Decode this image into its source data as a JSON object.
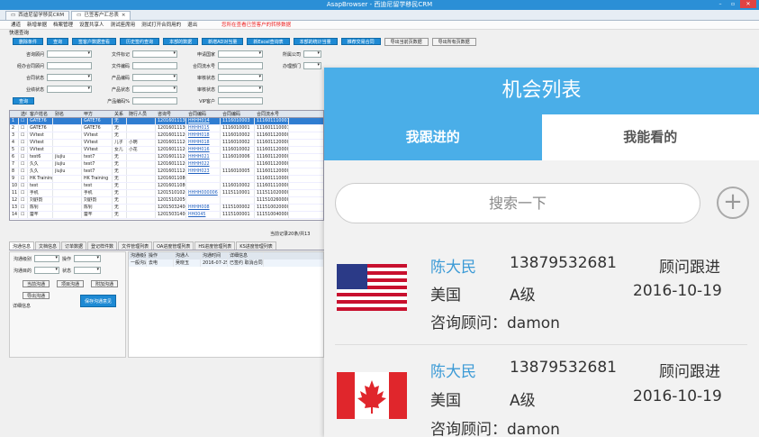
{
  "crm": {
    "window_title": "AsapBrowser - 西迪尼留学移民CRM",
    "tabs": [
      {
        "label": "西迪尼留学移民CRM"
      },
      {
        "label": "已签客户汇总表"
      }
    ],
    "menu": [
      "通道",
      "新增单据",
      "档案管理",
      "设置共享人",
      "测试座席用",
      "测试打开合同用的",
      "退出"
    ],
    "menu_warning": "您所在查看已签客户的转移数据",
    "quick_label": "快速查询",
    "buttons": [
      "删除条件",
      "查询",
      "签客户数据查看",
      "历史签约查询",
      "本部的数据",
      "新增AD对当量",
      "新Excel查询表",
      "本部的统计当量",
      "推荐交易合同"
    ],
    "buttons2": [
      "导出当前页数据",
      "导出所有页数据"
    ],
    "form_labels": [
      "咨询顾问",
      "文件标记",
      "申请国家",
      "所属公司",
      "来自渠道",
      "合同生成日期",
      "经办合同顾问",
      "文件编码",
      "合同流水号",
      "办理部门",
      "合同状态",
      "产品编码",
      "审核状态",
      "业绩状态",
      "产品状态",
      "来源状态",
      "审核状态",
      "VIP客户",
      "产品编码%"
    ],
    "form_values": {
      "source": "D",
      "date_sep": "至"
    },
    "search_btn": "查询",
    "grid_headers": [
      "选中",
      "客户姓名",
      "别名",
      "甲方",
      "关系",
      "随行人员",
      "咨询号",
      "合同编码",
      "合同编码",
      "合同流水号"
    ],
    "rows": [
      {
        "n": "1",
        "name": "GATE76",
        "alias": "",
        "party": "GATE76",
        "rel": "无",
        "comp": "",
        "ask": "120160111300001",
        "code": "HHHH014",
        "code2": "1116010003",
        "serial": "1116011100012"
      },
      {
        "n": "2",
        "name": "GATE76",
        "alias": "",
        "party": "GATE76",
        "rel": "无",
        "comp": "",
        "ask": "120160111300001",
        "code": "HHHH015",
        "code2": "1116010001",
        "serial": "1116011100011"
      },
      {
        "n": "3",
        "name": "VVtest",
        "alias": "",
        "party": "VVtest",
        "rel": "无",
        "comp": "",
        "ask": "120160111200004",
        "code": "HHHH018",
        "code2": "1116010002",
        "serial": "1116011200001"
      },
      {
        "n": "4",
        "name": "VVtest",
        "alias": "",
        "party": "VVtest",
        "rel": "儿子",
        "comp": "小明",
        "ask": "120160111200004",
        "code": "HHHH018",
        "code2": "1116010002",
        "serial": "1116011200003"
      },
      {
        "n": "5",
        "name": "VVtest",
        "alias": "",
        "party": "VVtest",
        "rel": "女儿",
        "comp": "小花",
        "ask": "120160111200004",
        "code": "HHHH016",
        "code2": "1116010002",
        "serial": "1116011200002"
      },
      {
        "n": "6",
        "name": "test6",
        "alias": "jiujiu",
        "party": "test7",
        "rel": "无",
        "comp": "",
        "ask": "120160111200003",
        "code": "HHHH021",
        "code2": "1116010006",
        "serial": "1116011200004"
      },
      {
        "n": "7",
        "name": "久久",
        "alias": "jiujiu",
        "party": "test7",
        "rel": "无",
        "comp": "",
        "ask": "120160111200002",
        "code": "HHHH022",
        "code2": "",
        "serial": "1116011200003"
      },
      {
        "n": "8",
        "name": "久久",
        "alias": "jiujiu",
        "party": "test7",
        "rel": "无",
        "comp": "",
        "ask": "120160111200002",
        "code": "HHHH023",
        "code2": "1116010005",
        "serial": "1116011200002"
      },
      {
        "n": "9",
        "name": "HK Training",
        "alias": "",
        "party": "HK Training",
        "rel": "无",
        "comp": "",
        "ask": "120160110800001",
        "code": "",
        "code2": "",
        "serial": "1116011100001"
      },
      {
        "n": "10",
        "name": "test",
        "alias": "",
        "party": "test",
        "rel": "无",
        "comp": "",
        "ask": "120160110800002",
        "code": "",
        "code2": "1116010002",
        "serial": "1116011100002"
      },
      {
        "n": "11",
        "name": "手机",
        "alias": "",
        "party": "手机",
        "rel": "无",
        "comp": "",
        "ask": "120151010200003",
        "code": "HHHH000006",
        "code2": "1115110001",
        "serial": "1115110200001"
      },
      {
        "n": "12",
        "name": "刘舒韵",
        "alias": "",
        "party": "刘舒韵",
        "rel": "无",
        "comp": "",
        "ask": "120151020500001",
        "code": "",
        "code2": "",
        "serial": "1115102600001"
      },
      {
        "n": "13",
        "name": "陈钊",
        "alias": "",
        "party": "陈钊",
        "rel": "无",
        "comp": "",
        "ask": "120150324000001",
        "code": "HHHH008",
        "code2": "1115100002",
        "serial": "1115100200001"
      },
      {
        "n": "14",
        "name": "蕾芊",
        "alias": "",
        "party": "蕾芊",
        "rel": "无",
        "comp": "",
        "ask": "120150314000002",
        "code": "HH0045",
        "code2": "1115100001",
        "serial": "1115100400001"
      }
    ],
    "pager": "当前记录20条/共13",
    "detail_tabs": [
      "沟通信息",
      "文档信息",
      "订单数据",
      "登记样件数",
      "文件管理列表",
      "OA进度管理列表",
      "HS进度管理列表",
      "KS进度管理列表",
      "HS进度管理列表"
    ],
    "detail_fields": [
      {
        "label": "沟通级别",
        "label2": "操作"
      },
      {
        "label": "沟通目的",
        "label2": "状态"
      }
    ],
    "detail_buttons": [
      "当前沟通",
      "项目沟通",
      "附加沟通",
      "导出沟通",
      "保存沟通意见"
    ],
    "detail_label": "详细信息",
    "sub_headers": [
      "沟通级别",
      "操作",
      "沟通人",
      "沟通时间",
      "详细信息"
    ],
    "sub_row": {
      "level": "一般沟通级别",
      "op": "去电",
      "who": "吴晓玉",
      "time": "2016-07-25",
      "info": "已签约 取消合同"
    }
  },
  "mobile": {
    "title": "机会列表",
    "tabs": [
      {
        "label": "我跟进的",
        "active": true
      },
      {
        "label": "我能看的",
        "active": false
      }
    ],
    "search_placeholder": "搜索一下",
    "add_icon": "plus-icon",
    "colors": {
      "accent": "#4aaee8",
      "name": "#3d9bd6"
    },
    "cards": [
      {
        "flag": "us-flag-icon",
        "name": "陈大民",
        "phone": "13879532681",
        "stage": "顾问跟进",
        "country": "美国",
        "level": "A级",
        "date": "2016-10-19",
        "advisor": "咨询顾问：damon"
      },
      {
        "flag": "canada-flag-icon",
        "name": "陈大民",
        "phone": "13879532681",
        "stage": "顾问跟进",
        "country": "美国",
        "level": "A级",
        "date": "2016-10-19",
        "advisor": "咨询顾问：damon"
      }
    ]
  }
}
